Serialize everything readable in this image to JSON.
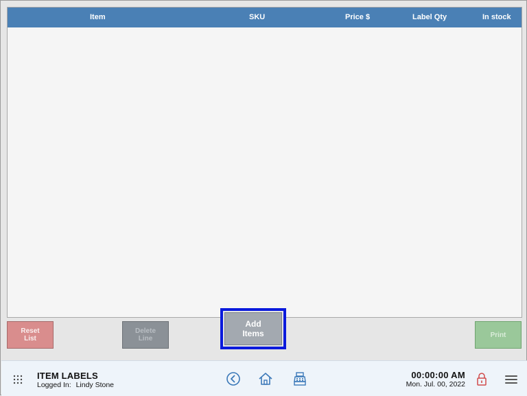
{
  "table": {
    "columns": [
      "Item",
      "SKU",
      "Price $",
      "Label Qty",
      "In stock"
    ],
    "rows": []
  },
  "actions": {
    "reset_label": "Reset\nList",
    "delete_label": "Delete\nLine",
    "add_label": "Add\nItems",
    "print_label": "Print"
  },
  "footer": {
    "app_title": "ITEM LABELS",
    "logged_in_label": "Logged In:",
    "user_name": "Lindy Stone",
    "time": "00:00:00 AM",
    "date": "Mon. Jul. 00, 2022"
  },
  "icons": {
    "grid": "grid-icon",
    "back": "back-circle-icon",
    "home": "home-icon",
    "register": "cash-register-icon",
    "lock": "lock-icon",
    "menu": "hamburger-menu-icon"
  },
  "colors": {
    "header_blue": "#4a80b5",
    "reset_red": "#d98d8d",
    "print_green": "#9ac89a",
    "highlight_blue": "#0a1adc",
    "icon_blue": "#3a78b8",
    "lock_red": "#d04a4a"
  }
}
